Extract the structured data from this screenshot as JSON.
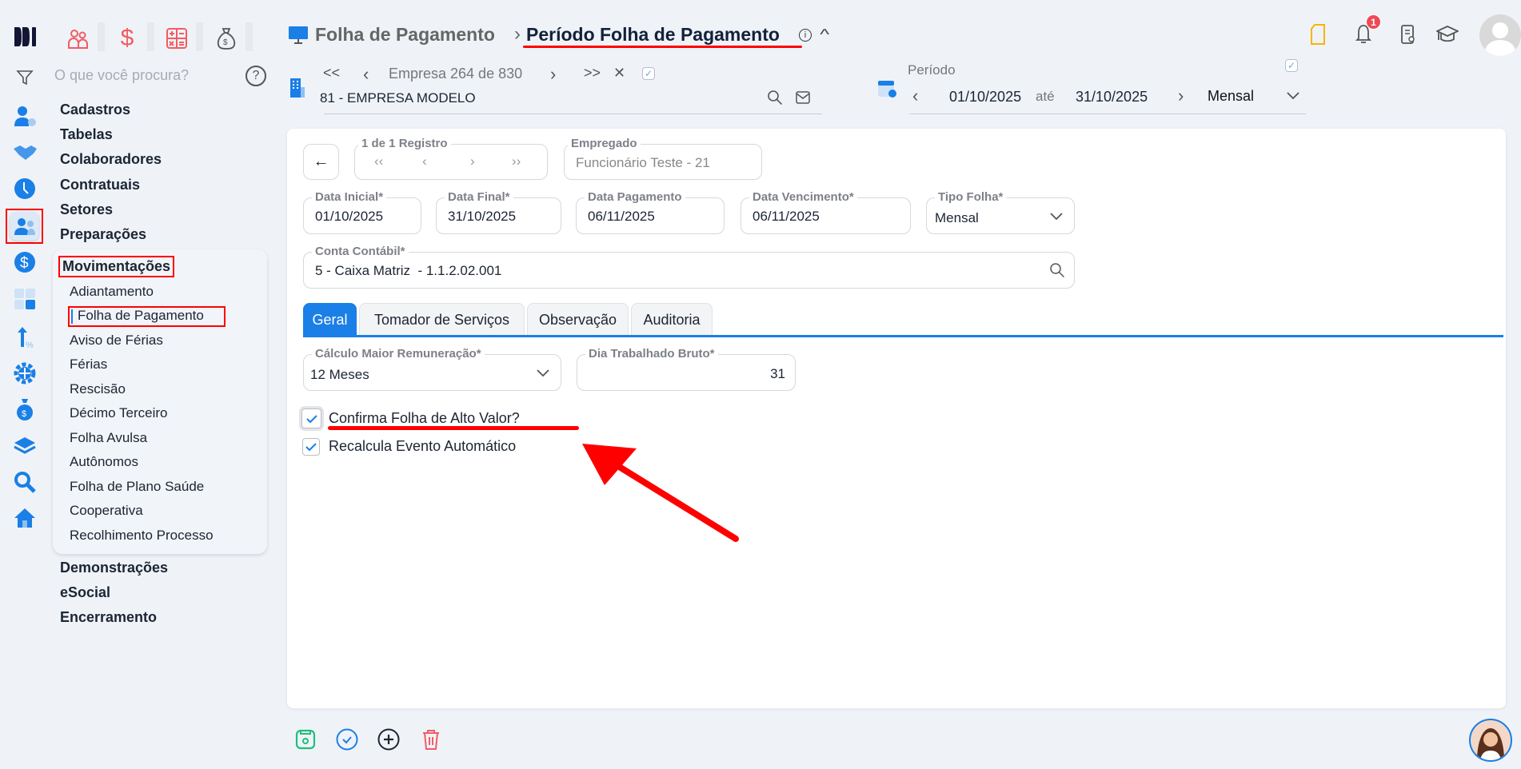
{
  "sidebar": {
    "search_placeholder": "O que você procura?",
    "menu": [
      "Cadastros",
      "Tabelas",
      "Colaboradores",
      "Contratuais",
      "Setores",
      "Preparações"
    ],
    "active_section": "Movimentações",
    "sub_items": [
      "Adiantamento",
      "Folha de Pagamento",
      "Aviso de Férias",
      "Férias",
      "Rescisão",
      "Décimo Terceiro",
      "Folha Avulsa",
      "Autônomos",
      "Folha de Plano Saúde",
      "Cooperativa",
      "Recolhimento Processo"
    ],
    "menu_after": [
      "Demonstrações",
      "eSocial",
      "Encerramento"
    ]
  },
  "header": {
    "breadcrumb_parent": "Folha de Pagamento",
    "breadcrumb_sep": "›",
    "title": "Período Folha de Pagamento",
    "notification_count": "1"
  },
  "empresa": {
    "nav_first": "<<",
    "nav_prev": "‹",
    "position": "Empresa 264 de 830",
    "nav_next": "›",
    "nav_last": ">>",
    "clear": "✕",
    "value": "81 - EMPRESA MODELO"
  },
  "periodo": {
    "label": "Período",
    "start": "01/10/2025",
    "sep": "até",
    "end": "31/10/2025",
    "type": "Mensal"
  },
  "form": {
    "registro_label": "1 de 1 Registro",
    "empregado_label": "Empregado",
    "empregado_value": "Funcionário Teste - 21",
    "data_inicial_label": "Data Inicial*",
    "data_inicial": "01/10/2025",
    "data_final_label": "Data Final*",
    "data_final": "31/10/2025",
    "data_pagamento_label": "Data Pagamento",
    "data_pagamento": "06/11/2025",
    "data_vencimento_label": "Data Vencimento*",
    "data_vencimento": "06/11/2025",
    "tipo_folha_label": "Tipo Folha*",
    "tipo_folha": "Mensal",
    "conta_label": "Conta Contábil*",
    "conta_value": "5 - Caixa Matriz  - 1.1.2.02.001",
    "tabs": [
      "Geral",
      "Tomador de Serviços",
      "Observação",
      "Auditoria"
    ],
    "calculo_label": "Cálculo Maior Remuneração*",
    "calculo_value": "12 Meses",
    "dia_label": "Dia Trabalhado Bruto*",
    "dia_value": "31",
    "check1": "Confirma Folha de Alto Valor?",
    "check2": "Recalcula Evento Automático"
  },
  "colors": {
    "accent": "#1a7fe6",
    "annotation": "#ff0000",
    "save": "#1fbf7a",
    "delete": "#f25c63"
  }
}
